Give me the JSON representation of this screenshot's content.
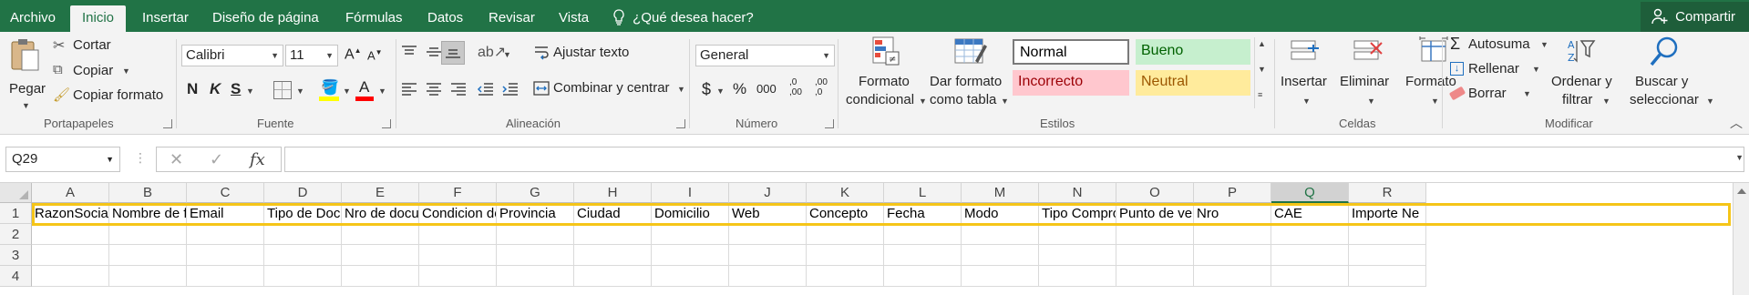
{
  "tabs": [
    "Archivo",
    "Inicio",
    "Insertar",
    "Diseño de página",
    "Fórmulas",
    "Datos",
    "Revisar",
    "Vista"
  ],
  "active_tab": "Inicio",
  "tell_me": "¿Qué desea hacer?",
  "share": "Compartir",
  "clipboard": {
    "paste": "Pegar",
    "cut": "Cortar",
    "copy": "Copiar",
    "format_painter": "Copiar formato",
    "label": "Portapapeles"
  },
  "font": {
    "name": "Calibri",
    "size": "11",
    "bold": "N",
    "italic": "K",
    "underline": "S",
    "label": "Fuente",
    "highlight_color": "#ffff00",
    "font_color": "#ff0000"
  },
  "alignment": {
    "wrap": "Ajustar texto",
    "merge": "Combinar y centrar",
    "label": "Alineación"
  },
  "number": {
    "format": "General",
    "currency": "$",
    "percent": "%",
    "thousands": "000",
    "inc_decimal": ",0\n,00",
    "dec_decimal": ",00\n,0",
    "label": "Número"
  },
  "styles": {
    "conditional": [
      "Formato",
      "condicional"
    ],
    "as_table": [
      "Dar formato",
      "como tabla"
    ],
    "normal": "Normal",
    "good": "Bueno",
    "bad": "Incorrecto",
    "neutral": "Neutral",
    "label": "Estilos",
    "colors": {
      "good_bg": "#c6efce",
      "good_fg": "#006100",
      "bad_bg": "#ffc7ce",
      "bad_fg": "#9c0006",
      "neutral_bg": "#ffeb9c",
      "neutral_fg": "#9c5700"
    }
  },
  "cells": {
    "insert": "Insertar",
    "delete": "Eliminar",
    "format": "Formato",
    "label": "Celdas"
  },
  "editing": {
    "autosum": "Autosuma",
    "fill": "Rellenar",
    "clear": "Borrar",
    "sort": [
      "Ordenar y",
      "filtrar"
    ],
    "find": [
      "Buscar y",
      "seleccionar"
    ],
    "label": "Modificar"
  },
  "formula_bar": {
    "name_box": "Q29",
    "formula": ""
  },
  "grid": {
    "columns": [
      "A",
      "B",
      "C",
      "D",
      "E",
      "F",
      "G",
      "H",
      "I",
      "J",
      "K",
      "L",
      "M",
      "N",
      "O",
      "P",
      "Q",
      "R"
    ],
    "selected_column": "Q",
    "rows": [
      "1",
      "2",
      "3",
      "4"
    ],
    "row1": [
      "RazonSocial",
      "Nombre de fa",
      "Email",
      "Tipo de Docur",
      "Nro de docum",
      "Condicion del",
      "Provincia",
      "Ciudad",
      "Domicilio",
      "Web",
      "Concepto",
      "Fecha",
      "Modo",
      "Tipo Comprob",
      "Punto de vent",
      "Nro",
      "CAE",
      "Importe Ne"
    ],
    "highlight_color": "#f5c518"
  }
}
